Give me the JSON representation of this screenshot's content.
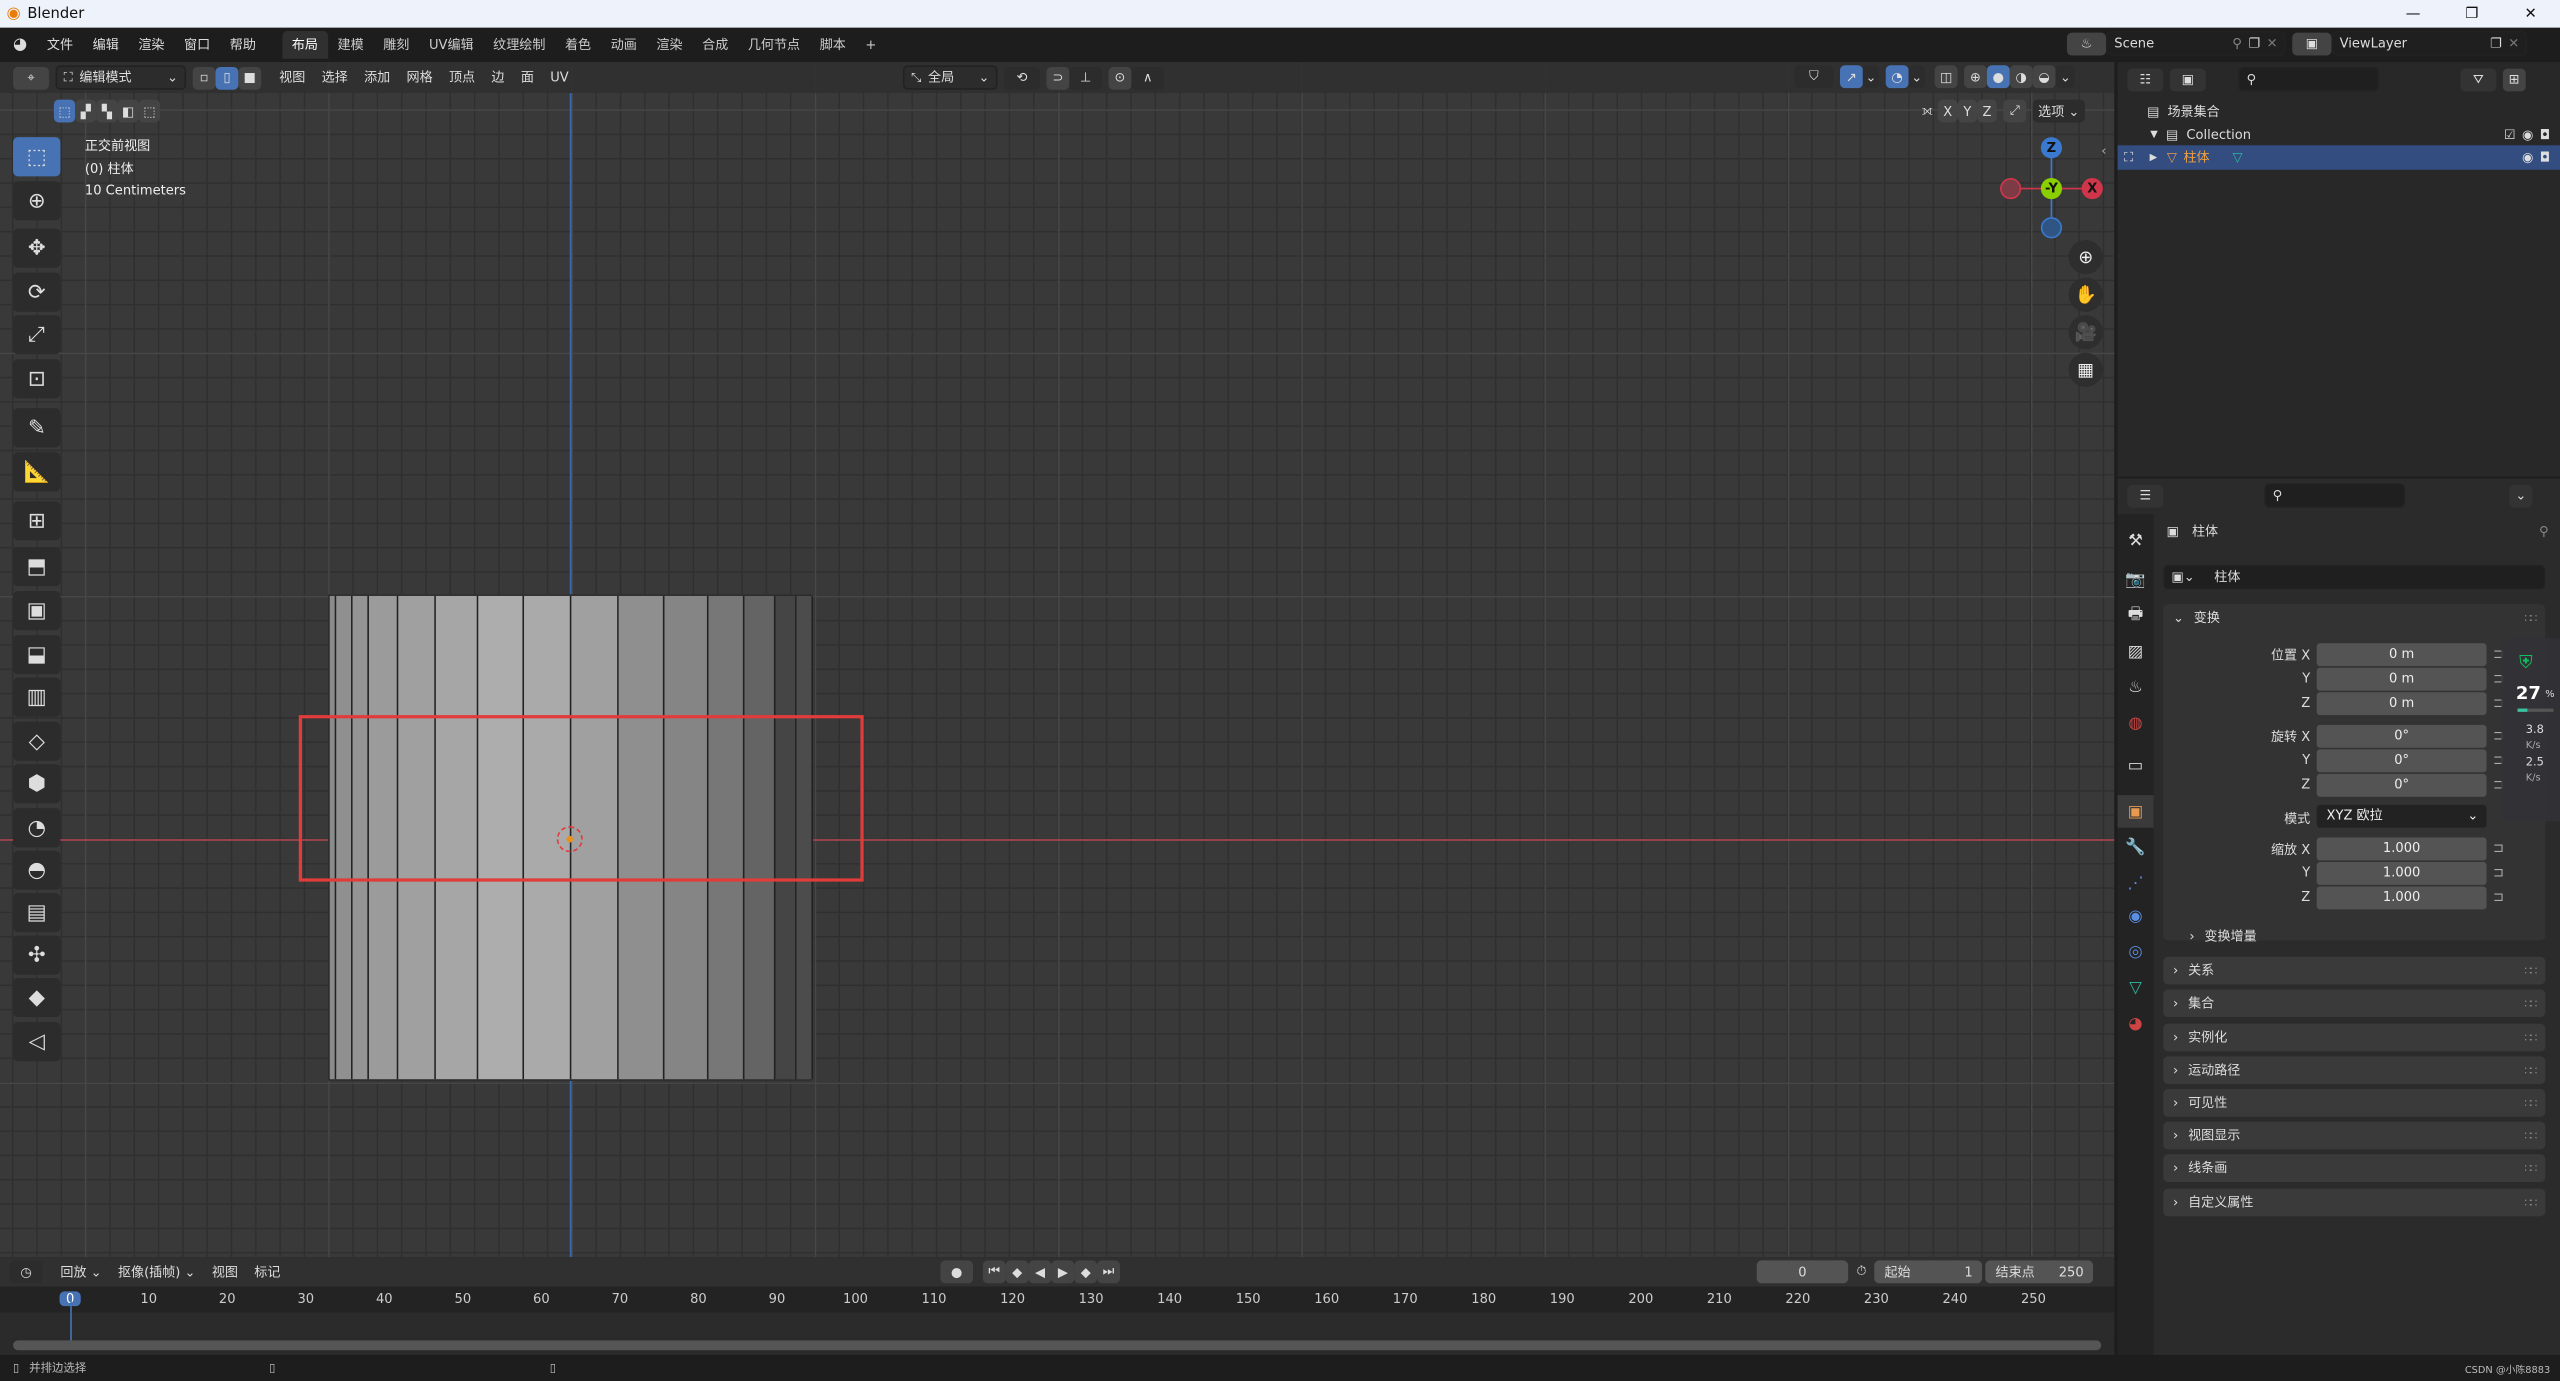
{
  "window": {
    "title": "Blender",
    "controls": [
      "—",
      "❐",
      "✕"
    ]
  },
  "topbar": {
    "menus": [
      "文件",
      "编辑",
      "渲染",
      "窗口",
      "帮助"
    ],
    "workspaces": [
      "布局",
      "建模",
      "雕刻",
      "UV编辑",
      "纹理绘制",
      "着色",
      "动画",
      "渲染",
      "合成",
      "几何节点",
      "脚本"
    ],
    "active_workspace": "布局",
    "add_workspace": "+",
    "scene": "Scene",
    "view_layer": "ViewLayer"
  },
  "viewport": {
    "mode": "编辑模式",
    "menus": [
      "视图",
      "选择",
      "添加",
      "网格",
      "顶点",
      "边",
      "面",
      "UV"
    ],
    "transform_orientation": "全局",
    "axis_toggles": [
      "X",
      "Y",
      "Z"
    ],
    "options_label": "选项",
    "overlay_info": {
      "view_name": "正交前视图",
      "object": "(0) 柱体",
      "scale": "10 Centimeters"
    },
    "gizmo": {
      "z": "Z",
      "y": "-Y",
      "x": "X"
    },
    "colors": {
      "selection_box": "#e03c3c",
      "x_axis": "#c4424e",
      "z_axis": "#3a6cb5",
      "gizmo_y": "#8acf00",
      "active": "#4772b3"
    },
    "tools": [
      "select-box",
      "cursor",
      "move",
      "rotate",
      "scale",
      "transform",
      "annotate",
      "measure",
      "add-cube",
      "extrude",
      "inset",
      "bevel",
      "loop-cut",
      "knife",
      "poly-build",
      "spin",
      "smooth",
      "edge-slide",
      "shrink-fatten",
      "shear",
      "rip"
    ]
  },
  "outliner": {
    "root": "场景集合",
    "collection": "Collection",
    "object": "柱体"
  },
  "properties": {
    "object_name": "柱体",
    "data_name": "柱体",
    "transform_header": "变换",
    "location_label": "位置 X",
    "rotation_label": "旋转 X",
    "scale_label": "缩放 X",
    "y_label": "Y",
    "z_label": "Z",
    "location": [
      "0 m",
      "0 m",
      "0 m"
    ],
    "rotation": [
      "0°",
      "0°",
      "0°"
    ],
    "mode_label": "模式",
    "rotation_mode": "XYZ 欧拉",
    "scale": [
      "1.000",
      "1.000",
      "1.000"
    ],
    "delta_transform": "变换增量",
    "panels": [
      "关系",
      "集合",
      "实例化",
      "运动路径",
      "可见性",
      "视图显示",
      "线条画",
      "自定义属性"
    ],
    "overlay_widget": {
      "percent": "27",
      "percent_unit": "%",
      "up": "3.8",
      "down": "2.5",
      "unit": "K/s"
    }
  },
  "timeline": {
    "menus": [
      "回放",
      "抠像(插帧)",
      "视图",
      "标记"
    ],
    "current_frame": "0",
    "start_label": "起始",
    "start": "1",
    "end_label": "结束点",
    "end": "250",
    "ticks": [
      "0",
      "10",
      "20",
      "30",
      "40",
      "50",
      "60",
      "70",
      "80",
      "90",
      "100",
      "110",
      "120",
      "130",
      "140",
      "150",
      "160",
      "170",
      "180",
      "190",
      "200",
      "210",
      "220",
      "230",
      "240",
      "250"
    ]
  },
  "statusbar": {
    "hint": "并排边选择",
    "watermark": "CSDN @小陈8883"
  }
}
